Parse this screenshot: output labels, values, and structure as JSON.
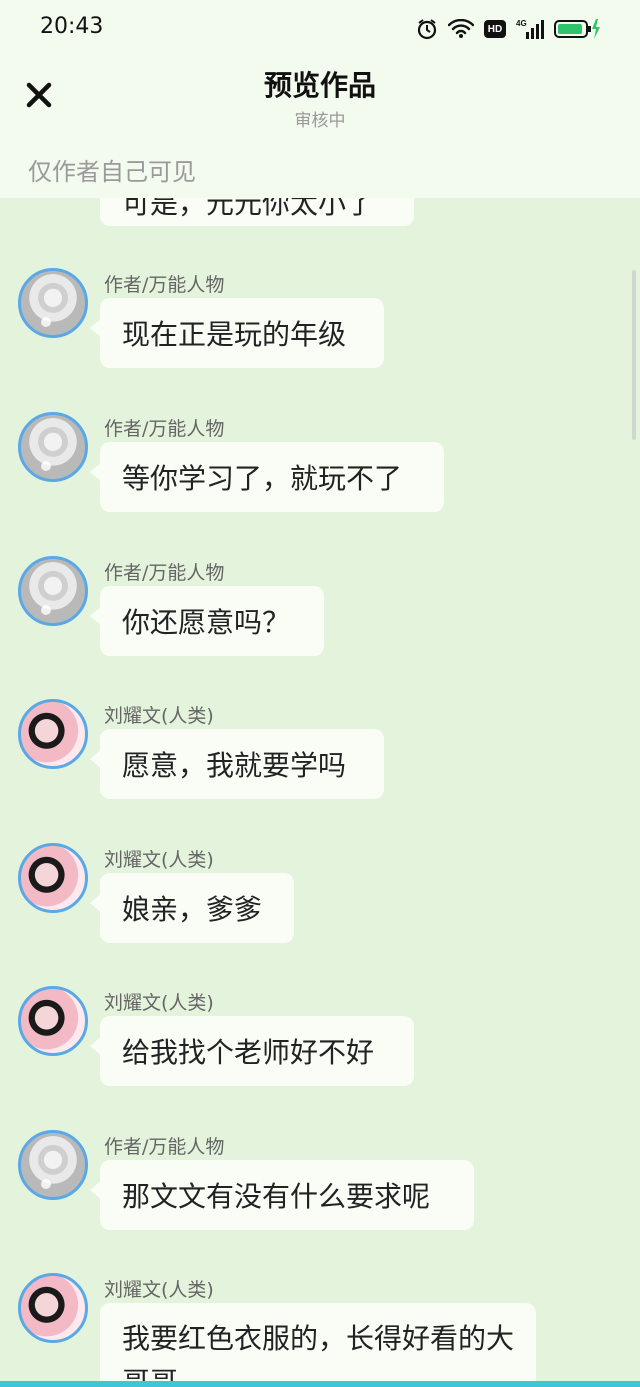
{
  "status_bar": {
    "time": "20:43",
    "network": "4G",
    "hd": "HD",
    "icons": [
      "alarm-icon",
      "wifi-icon",
      "hd-icon",
      "signal-icon",
      "battery-charging-icon"
    ]
  },
  "header": {
    "title": "预览作品",
    "subtitle": "审核中",
    "close_icon": "close-icon",
    "visibility_note": "仅作者自己可见"
  },
  "chat": {
    "partial_top_text": "可是，元元你太小了",
    "messages": [
      {
        "sender": "作者/万能人物",
        "text": "现在正是玩的年级",
        "avatar": "author"
      },
      {
        "sender": "作者/万能人物",
        "text": "等你学习了，就玩不了",
        "avatar": "author"
      },
      {
        "sender": "作者/万能人物",
        "text": "你还愿意吗？",
        "avatar": "author"
      },
      {
        "sender": "刘耀文(人类)",
        "text": "愿意，我就要学吗",
        "avatar": "human"
      },
      {
        "sender": "刘耀文(人类)",
        "text": "娘亲，爹爹",
        "avatar": "human"
      },
      {
        "sender": "刘耀文(人类)",
        "text": "给我找个老师好不好",
        "avatar": "human"
      },
      {
        "sender": "作者/万能人物",
        "text": "那文文有没有什么要求呢",
        "avatar": "author"
      },
      {
        "sender": "刘耀文(人类)",
        "text": "我要红色衣服的，长得好看的大哥哥",
        "avatar": "human"
      }
    ]
  },
  "colors": {
    "background": "#e4f4dc",
    "header_background": "#f2fbee",
    "bubble": "#f9fdf6",
    "avatar_ring": "#5aa8e6",
    "battery": "#2fc46b"
  }
}
